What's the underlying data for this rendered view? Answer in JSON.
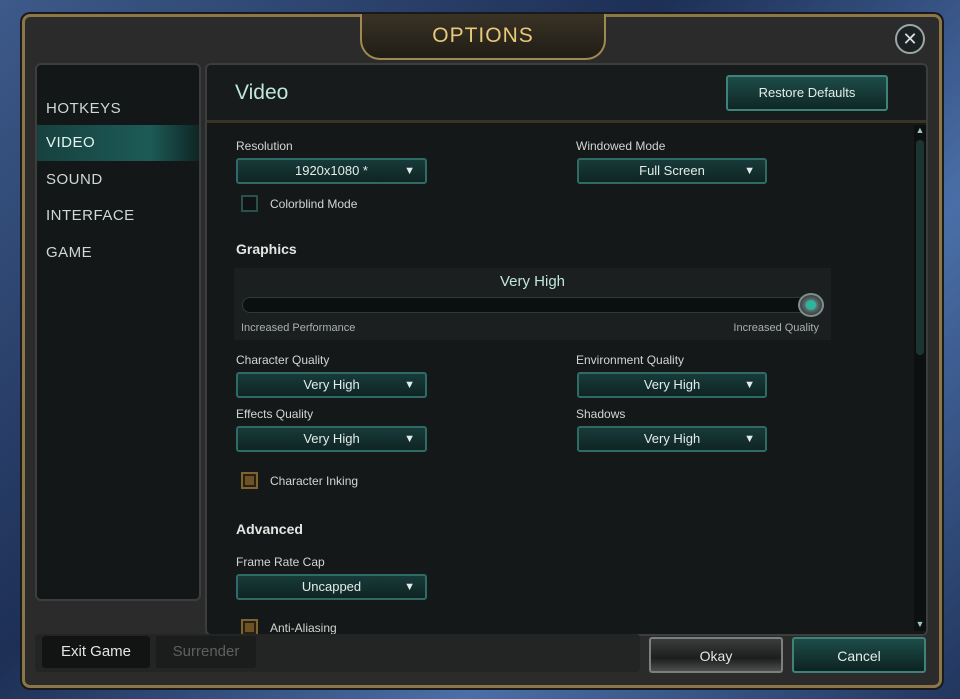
{
  "dialog": {
    "title": "OPTIONS",
    "close_icon": "close-x-icon"
  },
  "sidebar": {
    "items": [
      {
        "label": "HOTKEYS"
      },
      {
        "label": "VIDEO",
        "active": true
      },
      {
        "label": "SOUND"
      },
      {
        "label": "INTERFACE"
      },
      {
        "label": "GAME"
      }
    ]
  },
  "main": {
    "title": "Video",
    "restore_label": "Restore Defaults",
    "resolution": {
      "label": "Resolution",
      "value": "1920x1080 *"
    },
    "windowed": {
      "label": "Windowed Mode",
      "value": "Full Screen"
    },
    "colorblind": {
      "label": "Colorblind Mode",
      "checked": false
    },
    "graphics": {
      "heading": "Graphics",
      "level": "Very High",
      "slider_fraction": 1.0,
      "min_label": "Increased Performance",
      "max_label": "Increased Quality"
    },
    "character_quality": {
      "label": "Character Quality",
      "value": "Very High"
    },
    "environment_quality": {
      "label": "Environment Quality",
      "value": "Very High"
    },
    "effects_quality": {
      "label": "Effects Quality",
      "value": "Very High"
    },
    "shadows": {
      "label": "Shadows",
      "value": "Very High"
    },
    "character_inking": {
      "label": "Character Inking",
      "checked": true
    },
    "advanced": {
      "heading": "Advanced"
    },
    "frame_rate": {
      "label": "Frame Rate Cap",
      "value": "Uncapped"
    },
    "anti_aliasing": {
      "label": "Anti-Aliasing",
      "checked": true
    }
  },
  "footer": {
    "exit": "Exit Game",
    "surrender": "Surrender",
    "okay": "Okay",
    "cancel": "Cancel"
  },
  "colors": {
    "accent": "#1c5b57",
    "gold": "#e8c97a"
  }
}
